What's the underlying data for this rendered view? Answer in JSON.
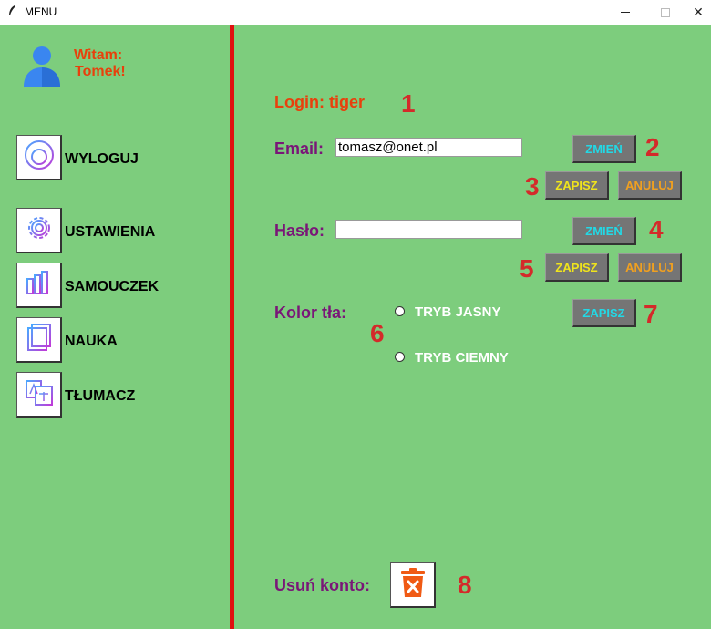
{
  "window": {
    "title": "MENU",
    "close_glyph": "✕"
  },
  "sidebar": {
    "welcome_line1": "Witam:",
    "welcome_line2": "Tomek!",
    "items": [
      {
        "label": "WYLOGUJ",
        "icon": "logout-icon"
      },
      {
        "label": "USTAWIENIA",
        "icon": "gear-icon"
      },
      {
        "label": "SAMOUCZEK",
        "icon": "books-icon"
      },
      {
        "label": "NAUKA",
        "icon": "study-icon"
      },
      {
        "label": "TŁUMACZ",
        "icon": "translate-icon"
      }
    ]
  },
  "main": {
    "login_text": "Login: tiger",
    "email_label": "Email:",
    "email_value": "tomasz@onet.pl",
    "password_label": "Hasło:",
    "password_value": "",
    "color_label": "Kolor tła:",
    "change_label": "ZMIEŃ",
    "save_label": "ZAPISZ",
    "cancel_label": "ANULUJ",
    "radio_light": "TRYB JASNY",
    "radio_dark": "TRYB CIEMNY",
    "delete_label": "Usuń konto:",
    "markers": [
      "1",
      "2",
      "3",
      "4",
      "5",
      "6",
      "7",
      "8"
    ]
  },
  "colors": {
    "background": "#7dcd7d",
    "divider": "#e01010",
    "accent_orange": "#e8400c",
    "label_purple": "#7a1678",
    "marker_red": "#d42a2a",
    "button_gray": "#757575"
  }
}
